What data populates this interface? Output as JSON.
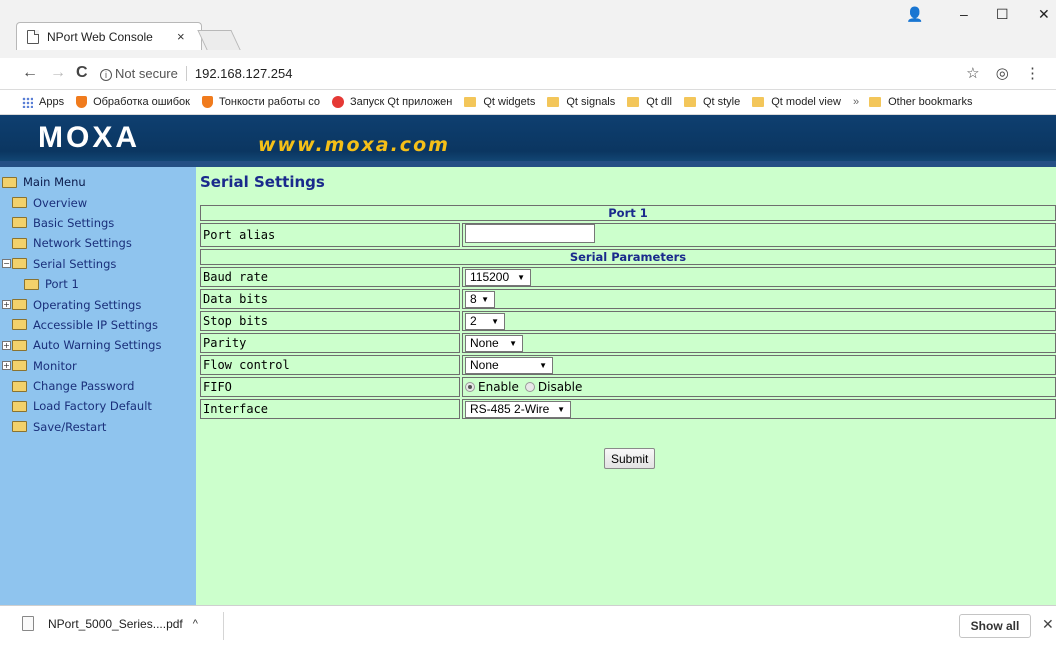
{
  "browser": {
    "tab_title": "NPort Web Console",
    "tab_close": "×",
    "window_controls": {
      "account": "👤",
      "minimize": "–",
      "maximize": "☐",
      "close": "✕"
    },
    "nav": {
      "back": "←",
      "forward": "→",
      "reload": "C"
    },
    "security_label": "Not secure",
    "security_icon": "i",
    "url": "192.168.127.254",
    "star_icon": "☆",
    "extension_icon": "◎",
    "menu_icon": "⋮",
    "bookmarks": [
      {
        "label": "Apps",
        "icon": "apps"
      },
      {
        "label": "Обработка ошибок",
        "icon": "shield"
      },
      {
        "label": "Тонкости работы со",
        "icon": "shield"
      },
      {
        "label": "Запуск Qt приложен",
        "icon": "qt"
      },
      {
        "label": "Qt widgets",
        "icon": "folder"
      },
      {
        "label": "Qt signals",
        "icon": "folder"
      },
      {
        "label": "Qt dll",
        "icon": "folder"
      },
      {
        "label": "Qt style",
        "icon": "folder"
      },
      {
        "label": "Qt model view",
        "icon": "folder"
      }
    ],
    "bookmarks_overflow": "»",
    "other_bookmarks": "Other bookmarks"
  },
  "banner": {
    "logo": "MOXA",
    "url_text": "www.moxa.com"
  },
  "sidebar": {
    "items": [
      {
        "label": "Main Menu",
        "level": 0,
        "expander": ""
      },
      {
        "label": "Overview",
        "level": 1,
        "expander": ""
      },
      {
        "label": "Basic Settings",
        "level": 1,
        "expander": ""
      },
      {
        "label": "Network Settings",
        "level": 1,
        "expander": ""
      },
      {
        "label": "Serial Settings",
        "level": 1,
        "expander": "−"
      },
      {
        "label": "Port 1",
        "level": 2,
        "expander": ""
      },
      {
        "label": "Operating Settings",
        "level": 1,
        "expander": "+"
      },
      {
        "label": "Accessible IP Settings",
        "level": 1,
        "expander": ""
      },
      {
        "label": "Auto Warning Settings",
        "level": 1,
        "expander": "+"
      },
      {
        "label": "Monitor",
        "level": 1,
        "expander": "+"
      },
      {
        "label": "Change Password",
        "level": 1,
        "expander": ""
      },
      {
        "label": "Load Factory Default",
        "level": 1,
        "expander": ""
      },
      {
        "label": "Save/Restart",
        "level": 1,
        "expander": ""
      }
    ]
  },
  "main": {
    "title": "Serial Settings",
    "port_header": "Port 1",
    "port_alias_label": "Port alias",
    "port_alias_value": "",
    "params_header": "Serial Parameters",
    "baud_rate": {
      "label": "Baud rate",
      "value": "115200"
    },
    "data_bits": {
      "label": "Data bits",
      "value": "8"
    },
    "stop_bits": {
      "label": "Stop bits",
      "value": "2"
    },
    "parity": {
      "label": "Parity",
      "value": "None"
    },
    "flow_control": {
      "label": "Flow control",
      "value": "None"
    },
    "fifo": {
      "label": "FIFO",
      "enable": "Enable",
      "disable": "Disable",
      "selected": "Enable"
    },
    "interface": {
      "label": "Interface",
      "value": "RS-485 2-Wire"
    },
    "submit": "Submit",
    "dropdown_arrow": "▼"
  },
  "downloads": {
    "file": "NPort_5000_Series....pdf",
    "caret": "^",
    "show_all": "Show all",
    "close": "✕"
  },
  "colors": {
    "sidebar_bg": "#8fc4ee",
    "content_bg": "#ccffcc",
    "banner_bg": "#0b3661",
    "accent_text": "#1a2a8c",
    "logo_url": "#f5c018"
  }
}
